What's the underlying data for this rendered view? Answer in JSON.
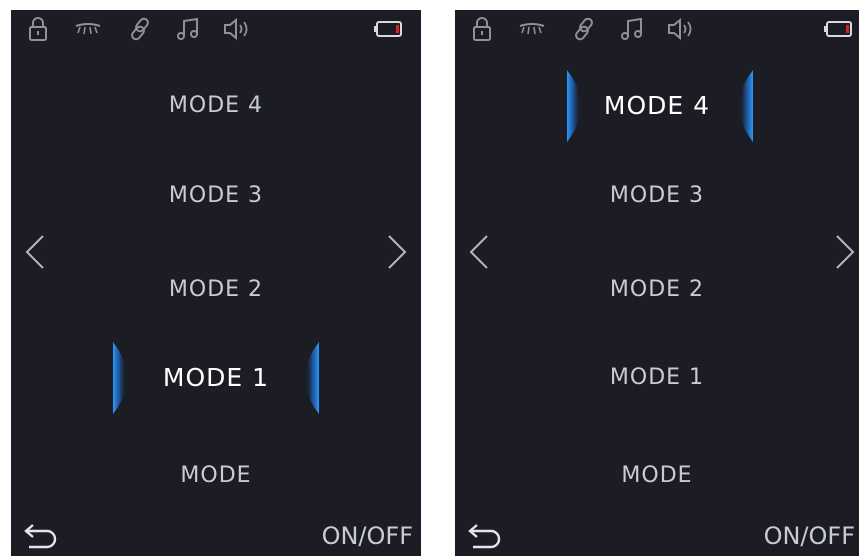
{
  "screens": [
    {
      "modes": [
        {
          "label": "MODE 4",
          "selected": false
        },
        {
          "label": "MODE 3",
          "selected": false
        },
        {
          "label": "MODE 2",
          "selected": false
        },
        {
          "label": "MODE 1",
          "selected": true
        },
        {
          "label": "MODE",
          "selected": false
        }
      ],
      "onoff_label": "ON/OFF"
    },
    {
      "modes": [
        {
          "label": "MODE 4",
          "selected": true
        },
        {
          "label": "MODE 3",
          "selected": false
        },
        {
          "label": "MODE 2",
          "selected": false
        },
        {
          "label": "MODE 1",
          "selected": false
        },
        {
          "label": "MODE",
          "selected": false
        }
      ],
      "onoff_label": "ON/OFF"
    }
  ],
  "status_icons": [
    "lock-icon",
    "eye-lashes-icon",
    "link-icon",
    "music-note-icon",
    "speaker-icon",
    "battery-icon"
  ],
  "colors": {
    "background": "#1b1c24",
    "text": "#c9cad2",
    "selected_text": "#ffffff",
    "accent_glow": "#1e8cff",
    "battery_low": "#e02020"
  }
}
